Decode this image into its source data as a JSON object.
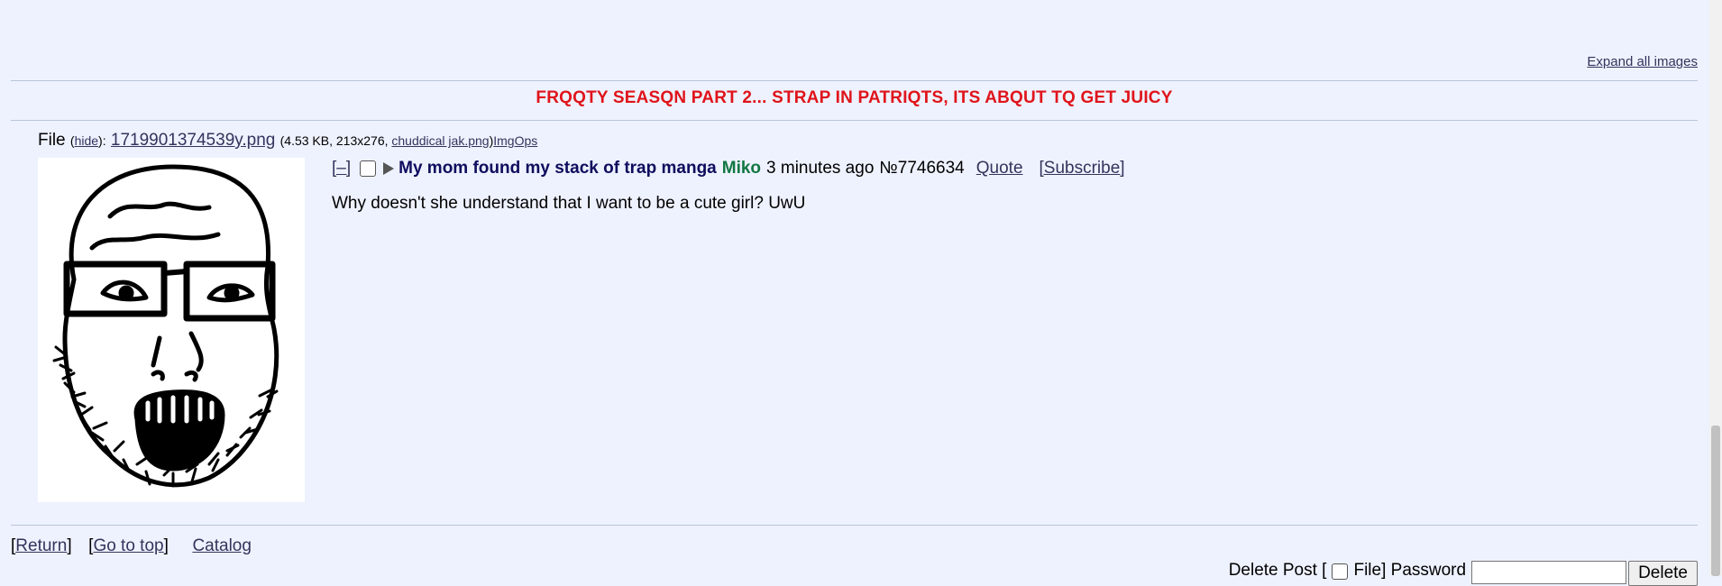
{
  "header": {
    "expand_all": "Expand all images",
    "announcement": "FRQQTY SEASQN PART 2... STRAP IN PATRIQTS, ITS ABQUT TQ GET JUICY"
  },
  "file": {
    "label": "File",
    "hide": "hide",
    "filename": "1719901374539y.png",
    "meta": "4.53 KB, 213x276,",
    "original_name": "chuddical jak.png",
    "imgops": "ImgOps"
  },
  "post": {
    "collapse": "[–]",
    "subject": "My mom found my stack of trap manga",
    "name": "Miko",
    "datetime": "3 minutes ago",
    "number": "№7746634",
    "quote": "Quote",
    "subscribe": "[Subscribe]",
    "body": "Why doesn't she understand that I want to be a cute girl? UwU"
  },
  "nav": {
    "return": "Return",
    "top": "Go to top",
    "catalog": "Catalog"
  },
  "delete": {
    "label_pre": "Delete Post [",
    "label_mid": "File] Password",
    "button": "Delete"
  },
  "colors": {
    "background": "#eef2ff",
    "announcement": "#e0141b",
    "subject": "#0f0c5d",
    "name": "#117743",
    "link": "#34345c"
  }
}
